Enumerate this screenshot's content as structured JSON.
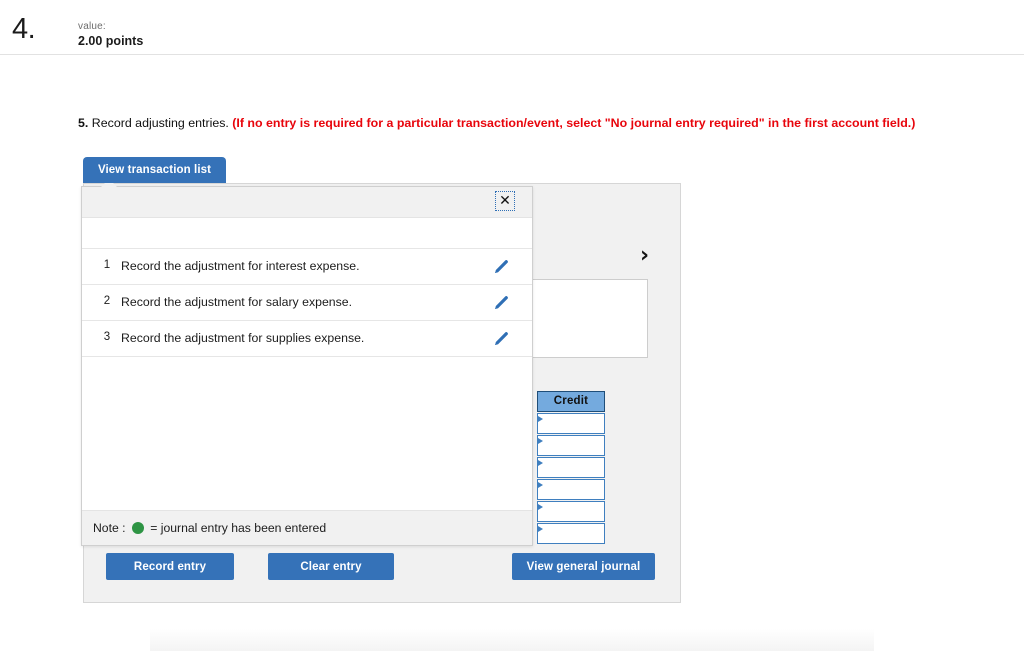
{
  "question_header": {
    "number": "4.",
    "value_label": "value:",
    "points": "2.00 points"
  },
  "instruction": {
    "number": "5.",
    "body": " Record adjusting entries. ",
    "warning": "(If no entry is required for a particular transaction/event, select \"No journal entry required\" in the first account field.)"
  },
  "tab": {
    "view_transaction_list": "View transaction list"
  },
  "transaction_popup": {
    "close_icon": "close-icon",
    "close_label": "✕",
    "rows": [
      {
        "index": "1",
        "description": "Record the adjustment for interest expense.",
        "edit_icon": "pencil-icon"
      },
      {
        "index": "2",
        "description": "Record the adjustment for salary expense.",
        "edit_icon": "pencil-icon"
      },
      {
        "index": "3",
        "description": "Record the adjustment for supplies expense.",
        "edit_icon": "pencil-icon"
      }
    ],
    "note_prefix": "Note : ",
    "note_suffix": " = journal entry has been entered",
    "note_dot_color": "#2e9444"
  },
  "journal_panel": {
    "next_chevron": "›",
    "credit_header": "Credit",
    "credit_cells": [
      "",
      "",
      "",
      "",
      "",
      ""
    ]
  },
  "actions": {
    "record_entry": "Record entry",
    "clear_entry": "Clear entry",
    "view_general_journal": "View general journal"
  },
  "colors": {
    "primary_blue": "#3572b8",
    "credit_header_blue": "#74aade",
    "credit_border_blue": "#3f7fbf",
    "warning_red": "#e8050c",
    "note_green": "#2e9444",
    "panel_gray": "#f1f1f1"
  }
}
